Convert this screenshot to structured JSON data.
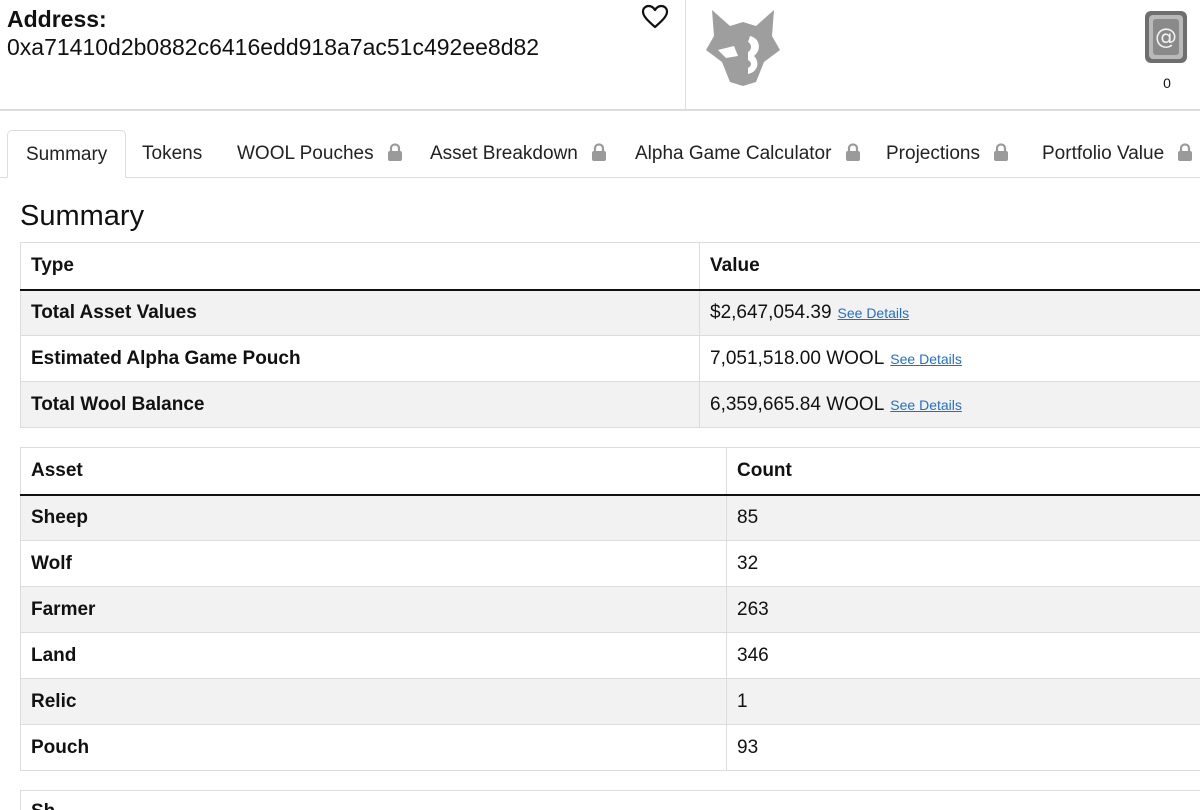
{
  "header": {
    "address_label": "Address:",
    "address_value": "0xa71410d2b0882c6416edd918a7ac51c492ee8d82",
    "favorite_icon": "heart-outline-icon",
    "logo_icon": "wolf-head-icon",
    "card_icon": "alpha-card-icon",
    "card_count": "0"
  },
  "tabs": [
    {
      "label": "Summary",
      "active": true,
      "locked": false
    },
    {
      "label": "Tokens",
      "active": false,
      "locked": false
    },
    {
      "label": "WOOL Pouches",
      "active": false,
      "locked": true
    },
    {
      "label": "Asset Breakdown",
      "active": false,
      "locked": true
    },
    {
      "label": "Alpha Game Calculator",
      "active": false,
      "locked": true
    },
    {
      "label": "Projections",
      "active": false,
      "locked": true
    },
    {
      "label": "Portfolio Value",
      "active": false,
      "locked": true
    }
  ],
  "summary": {
    "title": "Summary",
    "headers": [
      "Type",
      "Value"
    ],
    "link_label": "See Details",
    "rows": [
      {
        "type": "Total Asset Values",
        "value": "$2,647,054.39"
      },
      {
        "type": "Estimated Alpha Game Pouch",
        "value": "7,051,518.00 WOOL"
      },
      {
        "type": "Total Wool Balance",
        "value": "6,359,665.84 WOOL"
      }
    ]
  },
  "assets": {
    "headers": [
      "Asset",
      "Count"
    ],
    "rows": [
      {
        "asset": "Sheep",
        "count": "85"
      },
      {
        "asset": "Wolf",
        "count": "32"
      },
      {
        "asset": "Farmer",
        "count": "263"
      },
      {
        "asset": "Land",
        "count": "346"
      },
      {
        "asset": "Relic",
        "count": "1"
      },
      {
        "asset": "Pouch",
        "count": "93"
      }
    ]
  },
  "next_section": {
    "partial_label": "Sh"
  },
  "colors": {
    "link": "#1f6fd0",
    "stripe": "#f2f2f2",
    "border": "#dcdcdc",
    "logo": "#9e9e9e"
  }
}
